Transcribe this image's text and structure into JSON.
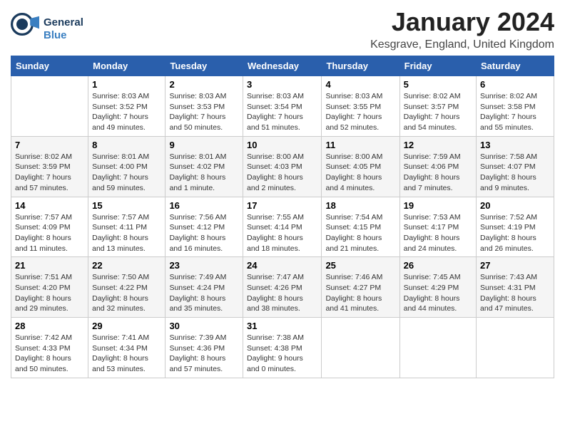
{
  "logo": {
    "line1": "General",
    "line2": "Blue"
  },
  "title": "January 2024",
  "location": "Kesgrave, England, United Kingdom",
  "days_of_week": [
    "Sunday",
    "Monday",
    "Tuesday",
    "Wednesday",
    "Thursday",
    "Friday",
    "Saturday"
  ],
  "weeks": [
    [
      {
        "day": "",
        "info": ""
      },
      {
        "day": "1",
        "info": "Sunrise: 8:03 AM\nSunset: 3:52 PM\nDaylight: 7 hours\nand 49 minutes."
      },
      {
        "day": "2",
        "info": "Sunrise: 8:03 AM\nSunset: 3:53 PM\nDaylight: 7 hours\nand 50 minutes."
      },
      {
        "day": "3",
        "info": "Sunrise: 8:03 AM\nSunset: 3:54 PM\nDaylight: 7 hours\nand 51 minutes."
      },
      {
        "day": "4",
        "info": "Sunrise: 8:03 AM\nSunset: 3:55 PM\nDaylight: 7 hours\nand 52 minutes."
      },
      {
        "day": "5",
        "info": "Sunrise: 8:02 AM\nSunset: 3:57 PM\nDaylight: 7 hours\nand 54 minutes."
      },
      {
        "day": "6",
        "info": "Sunrise: 8:02 AM\nSunset: 3:58 PM\nDaylight: 7 hours\nand 55 minutes."
      }
    ],
    [
      {
        "day": "7",
        "info": "Sunrise: 8:02 AM\nSunset: 3:59 PM\nDaylight: 7 hours\nand 57 minutes."
      },
      {
        "day": "8",
        "info": "Sunrise: 8:01 AM\nSunset: 4:00 PM\nDaylight: 7 hours\nand 59 minutes."
      },
      {
        "day": "9",
        "info": "Sunrise: 8:01 AM\nSunset: 4:02 PM\nDaylight: 8 hours\nand 1 minute."
      },
      {
        "day": "10",
        "info": "Sunrise: 8:00 AM\nSunset: 4:03 PM\nDaylight: 8 hours\nand 2 minutes."
      },
      {
        "day": "11",
        "info": "Sunrise: 8:00 AM\nSunset: 4:05 PM\nDaylight: 8 hours\nand 4 minutes."
      },
      {
        "day": "12",
        "info": "Sunrise: 7:59 AM\nSunset: 4:06 PM\nDaylight: 8 hours\nand 7 minutes."
      },
      {
        "day": "13",
        "info": "Sunrise: 7:58 AM\nSunset: 4:07 PM\nDaylight: 8 hours\nand 9 minutes."
      }
    ],
    [
      {
        "day": "14",
        "info": "Sunrise: 7:57 AM\nSunset: 4:09 PM\nDaylight: 8 hours\nand 11 minutes."
      },
      {
        "day": "15",
        "info": "Sunrise: 7:57 AM\nSunset: 4:11 PM\nDaylight: 8 hours\nand 13 minutes."
      },
      {
        "day": "16",
        "info": "Sunrise: 7:56 AM\nSunset: 4:12 PM\nDaylight: 8 hours\nand 16 minutes."
      },
      {
        "day": "17",
        "info": "Sunrise: 7:55 AM\nSunset: 4:14 PM\nDaylight: 8 hours\nand 18 minutes."
      },
      {
        "day": "18",
        "info": "Sunrise: 7:54 AM\nSunset: 4:15 PM\nDaylight: 8 hours\nand 21 minutes."
      },
      {
        "day": "19",
        "info": "Sunrise: 7:53 AM\nSunset: 4:17 PM\nDaylight: 8 hours\nand 24 minutes."
      },
      {
        "day": "20",
        "info": "Sunrise: 7:52 AM\nSunset: 4:19 PM\nDaylight: 8 hours\nand 26 minutes."
      }
    ],
    [
      {
        "day": "21",
        "info": "Sunrise: 7:51 AM\nSunset: 4:20 PM\nDaylight: 8 hours\nand 29 minutes."
      },
      {
        "day": "22",
        "info": "Sunrise: 7:50 AM\nSunset: 4:22 PM\nDaylight: 8 hours\nand 32 minutes."
      },
      {
        "day": "23",
        "info": "Sunrise: 7:49 AM\nSunset: 4:24 PM\nDaylight: 8 hours\nand 35 minutes."
      },
      {
        "day": "24",
        "info": "Sunrise: 7:47 AM\nSunset: 4:26 PM\nDaylight: 8 hours\nand 38 minutes."
      },
      {
        "day": "25",
        "info": "Sunrise: 7:46 AM\nSunset: 4:27 PM\nDaylight: 8 hours\nand 41 minutes."
      },
      {
        "day": "26",
        "info": "Sunrise: 7:45 AM\nSunset: 4:29 PM\nDaylight: 8 hours\nand 44 minutes."
      },
      {
        "day": "27",
        "info": "Sunrise: 7:43 AM\nSunset: 4:31 PM\nDaylight: 8 hours\nand 47 minutes."
      }
    ],
    [
      {
        "day": "28",
        "info": "Sunrise: 7:42 AM\nSunset: 4:33 PM\nDaylight: 8 hours\nand 50 minutes."
      },
      {
        "day": "29",
        "info": "Sunrise: 7:41 AM\nSunset: 4:34 PM\nDaylight: 8 hours\nand 53 minutes."
      },
      {
        "day": "30",
        "info": "Sunrise: 7:39 AM\nSunset: 4:36 PM\nDaylight: 8 hours\nand 57 minutes."
      },
      {
        "day": "31",
        "info": "Sunrise: 7:38 AM\nSunset: 4:38 PM\nDaylight: 9 hours\nand 0 minutes."
      },
      {
        "day": "",
        "info": ""
      },
      {
        "day": "",
        "info": ""
      },
      {
        "day": "",
        "info": ""
      }
    ]
  ]
}
